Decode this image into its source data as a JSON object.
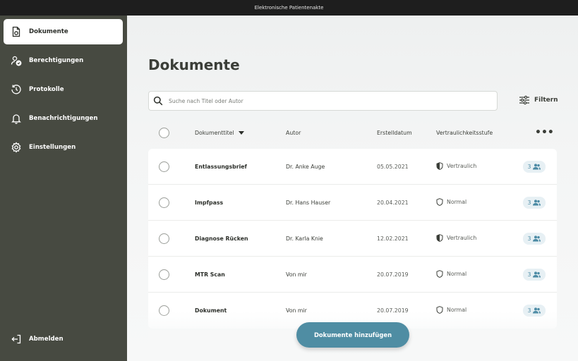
{
  "window": {
    "title": "Elektronische Patientenakte"
  },
  "sidebar": {
    "items": [
      {
        "label": "Dokumente",
        "icon": "document-icon",
        "active": true
      },
      {
        "label": "Berechtigungen",
        "icon": "user-permissions-icon"
      },
      {
        "label": "Protokolle",
        "icon": "history-icon"
      },
      {
        "label": "Benachrichtigungen",
        "icon": "bell-icon"
      },
      {
        "label": "Einstellungen",
        "icon": "gear-icon"
      }
    ],
    "logout": {
      "label": "Abmelden",
      "icon": "logout-icon"
    }
  },
  "main": {
    "title": "Dokumente",
    "search": {
      "placeholder": "Suche nach Titel oder Autor",
      "value": ""
    },
    "filter_label": "Filtern",
    "columns": {
      "title": "Dokumenttitel",
      "author": "Autor",
      "date": "Erstelldatum",
      "confidentiality": "Vertraulichkeitsstufe",
      "more": "•••"
    },
    "documents": [
      {
        "title": "Entlassungsbrief",
        "author": "Dr. Anke Auge",
        "date": "05.05.2021",
        "confidentiality": "Vertraulich",
        "level": "confidential",
        "shared": "3"
      },
      {
        "title": "Impfpass",
        "author": "Dr. Hans Hauser",
        "date": "20.04.2021",
        "confidentiality": "Normal",
        "level": "normal",
        "shared": "3"
      },
      {
        "title": "Diagnose Rücken",
        "author": "Dr. Karla Knie",
        "date": "12.02.2021",
        "confidentiality": "Vertraulich",
        "level": "confidential",
        "shared": "3"
      },
      {
        "title": "MTR Scan",
        "author": "Von mir",
        "date": "20.07.2019",
        "confidentiality": "Normal",
        "level": "normal",
        "shared": "3"
      },
      {
        "title": "Dokument",
        "author": "Von mir",
        "date": "20.07.2019",
        "confidentiality": "Normal",
        "level": "normal",
        "shared": "3"
      }
    ],
    "add_button": "Dokumente hinzufügen"
  },
  "colors": {
    "sidebar": "#474a41",
    "accent": "#4f8da3",
    "share_badge_bg": "#e7f0f4"
  }
}
